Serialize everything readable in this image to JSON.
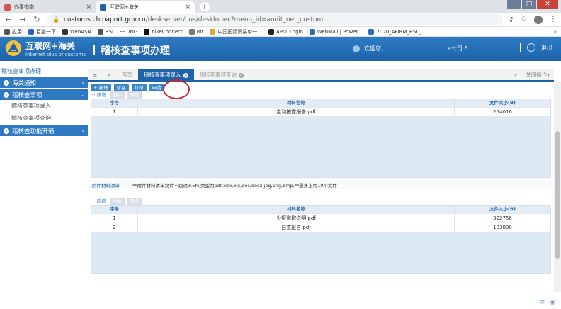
{
  "browser": {
    "tabs": [
      {
        "title": "办事指南",
        "active": false,
        "favicon_color": "#d9534f"
      },
      {
        "title": "互联网+海关",
        "active": true,
        "favicon_color": "#1d63aa"
      }
    ],
    "new_tab": "+",
    "window_controls": {
      "minimize": "–",
      "maximize": "□",
      "close": "✕"
    },
    "url_host": "customs.chinaport.gov.cn",
    "url_path": "/deskserver/cus/deskIndex?menu_id=audit_net_custom",
    "bookmarks": [
      {
        "label": "应用",
        "icon_color": "#555"
      },
      {
        "label": "百度一下",
        "icon_color": "#2a5cd6"
      },
      {
        "label": "WebASN",
        "icon_color": "#333"
      },
      {
        "label": "RSL TESTING",
        "icon_color": "#555"
      },
      {
        "label": "nikeConnect",
        "icon_color": "#111"
      },
      {
        "label": "Rit",
        "icon_color": "#777"
      },
      {
        "label": "中国国际贸易单一...",
        "icon_color": "#e3a43b"
      },
      {
        "label": "APLL Login",
        "icon_color": "#222"
      },
      {
        "label": "WebMail | Power...",
        "icon_color": "#2b6fb6"
      },
      {
        "label": "2020_AFIRM_RSL_...",
        "icon_color": "#2b6fb6"
      }
    ],
    "bookmarks_more": "»"
  },
  "header": {
    "logo_title": "互联网+海关",
    "logo_sub": "internet plus of customs",
    "system_name": "稽核查事项办理",
    "welcome": "欢迎您，",
    "company": "a公司 F",
    "logout": "退出"
  },
  "sidebar": {
    "title": "稽核查事项办理",
    "menu": [
      {
        "label": "海关通知",
        "arrow": "‹"
      },
      {
        "label": "稽核查事项",
        "arrow": "⌄",
        "children": [
          "稽核查事项录入",
          "稽核查事项查询"
        ]
      },
      {
        "label": "稽核查功能开通",
        "arrow": "‹"
      }
    ]
  },
  "tabs": {
    "back": "«",
    "home": "首页",
    "items": [
      {
        "label": "稽核查事项录入",
        "active": true
      },
      {
        "label": "稽核查事项查询",
        "active": false
      }
    ],
    "forward": "»",
    "close_ops": "关闭操作▾"
  },
  "toolbar": {
    "buttons": [
      "+ 新增",
      "暂存",
      "打印",
      "申请"
    ],
    "sub_buttons": [
      "+ 新增",
      "删除",
      "预览"
    ]
  },
  "materials_grid": {
    "headers": [
      "序号",
      "材料名称",
      "文件大小(B)"
    ],
    "rows": [
      {
        "no": "1",
        "name": "主动披露报告.pdf",
        "size": "254016"
      }
    ]
  },
  "attachment": {
    "label": "附件材料清单",
    "note": "**附件材料清单文件不超过3.5M,类型为pdf,xlsx,xls,doc,docx,jpg,png,bmp,**最多上传10个文件",
    "buttons": [
      "+ 新增",
      "删除",
      "预览"
    ],
    "headers": [
      "序号",
      "材料名称",
      "文件大小(B)"
    ],
    "rows": [
      {
        "no": "1",
        "name": "少报道歉说明.pdf",
        "size": "322756"
      },
      {
        "no": "2",
        "name": "自查报告.pdf",
        "size": "183800"
      }
    ]
  },
  "footer_icons": "⋮≡ ◉"
}
